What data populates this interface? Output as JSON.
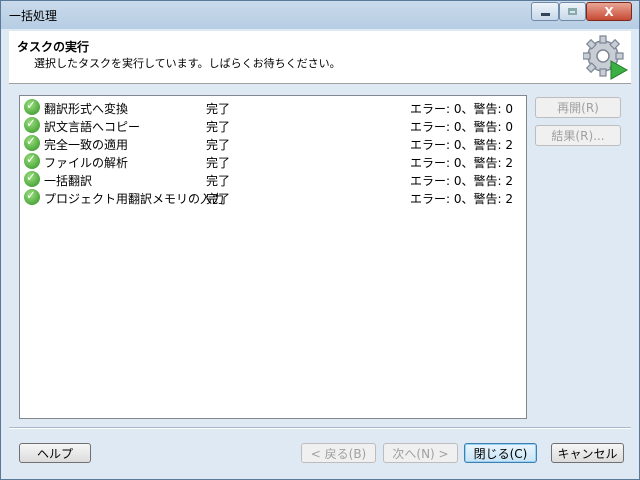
{
  "window": {
    "title": "一括処理",
    "close_label": "X"
  },
  "header": {
    "title": "タスクの実行",
    "subtitle": "選択したタスクを実行しています。しばらくお待ちください。"
  },
  "tasks": [
    {
      "name": "翻訳形式へ変換",
      "status": "完了",
      "result": "エラー: 0、警告: 0"
    },
    {
      "name": "訳文言語へコピー",
      "status": "完了",
      "result": "エラー: 0、警告: 0"
    },
    {
      "name": "完全一致の適用",
      "status": "完了",
      "result": "エラー: 0、警告: 2"
    },
    {
      "name": "ファイルの解析",
      "status": "完了",
      "result": "エラー: 0、警告: 2"
    },
    {
      "name": "一括翻訳",
      "status": "完了",
      "result": "エラー: 0、警告: 2"
    },
    {
      "name": "プロジェクト用翻訳メモリの入力",
      "status": "完了",
      "result": "エラー: 0、警告: 2"
    }
  ],
  "side_buttons": {
    "resume": "再開(R)",
    "results": "結果(R)..."
  },
  "footer": {
    "help": "ヘルプ",
    "back": "< 戻る(B)",
    "next": "次へ(N) >",
    "close": "閉じる(C)",
    "cancel": "キャンセル"
  },
  "colors": {
    "check_green": "#2f8f22",
    "accent_play": "#3cb043"
  },
  "icons": [
    "check-icon",
    "gear-icon",
    "play-icon",
    "minimize-icon",
    "maximize-icon",
    "close-icon"
  ]
}
